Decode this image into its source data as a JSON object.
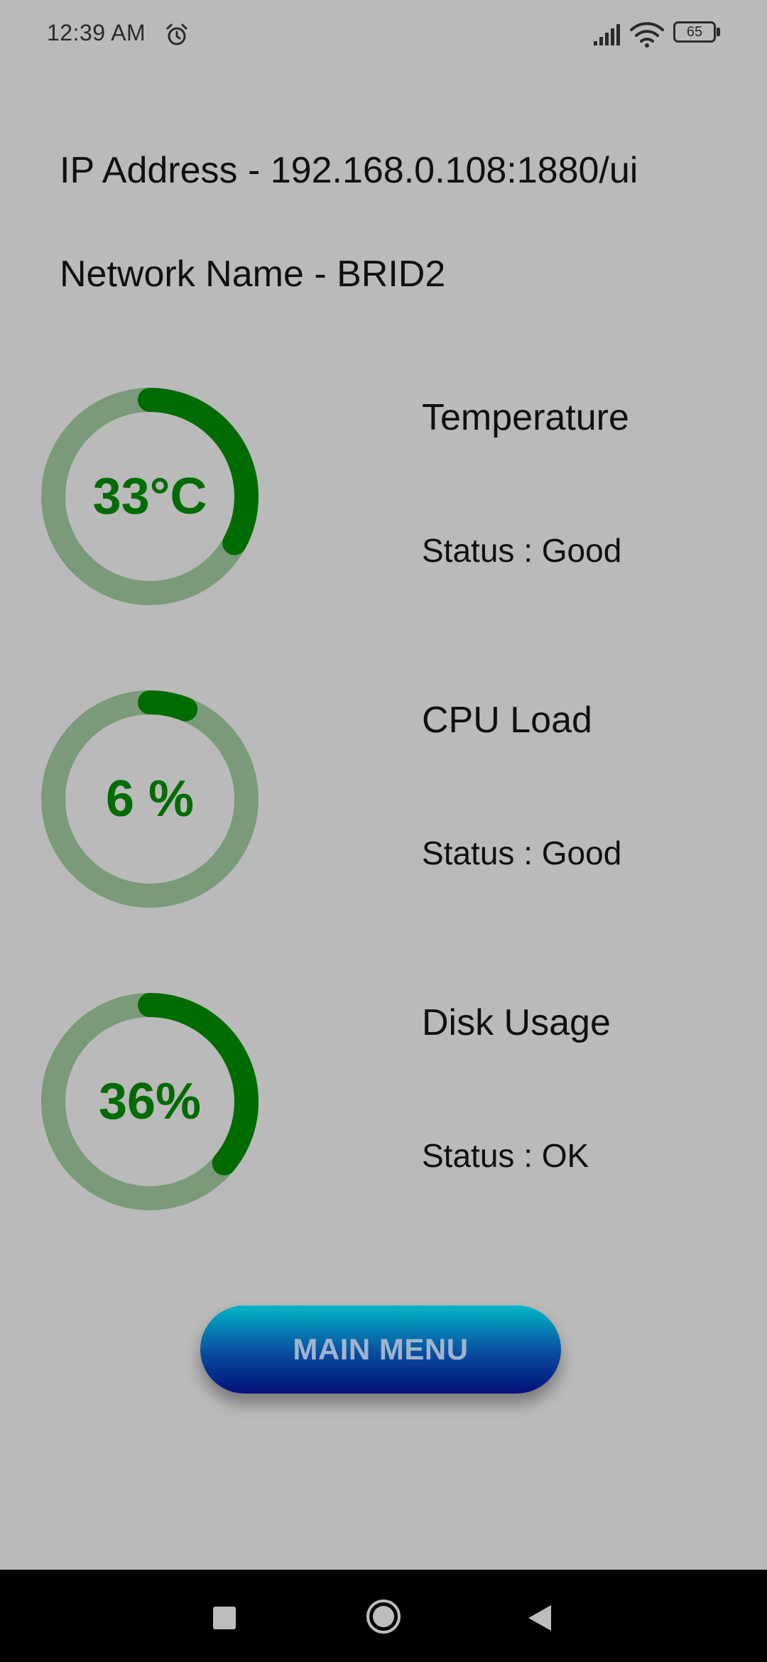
{
  "status_bar": {
    "time": "12:39 AM",
    "battery_level": "65",
    "icons": [
      "alarm-icon",
      "signal-icon",
      "wifi-icon",
      "battery-icon"
    ]
  },
  "network": {
    "ip_line": "IP Address - 192.168.0.108:1880/ui",
    "name_line": "Network Name - BRID2"
  },
  "metrics": [
    {
      "title": "Temperature",
      "value_text": "33°C",
      "status": "Status : Good",
      "fill_fraction": 0.33
    },
    {
      "title": "CPU Load",
      "value_text": "6 %",
      "status": "Status : Good",
      "fill_fraction": 0.06
    },
    {
      "title": "Disk Usage",
      "value_text": "36%",
      "status": "Status : OK",
      "fill_fraction": 0.36
    }
  ],
  "main_menu": {
    "label": "MAIN MENU"
  },
  "colors": {
    "background": "#bababa",
    "gauge_track": "#7a9a7a",
    "gauge_fill": "#006b00",
    "gauge_text": "#006b00",
    "button_top": "#00b6c6",
    "button_bottom": "#02107a",
    "button_text": "#9fb4cf"
  },
  "nav_bar": {
    "icons": [
      "recent-apps-icon",
      "home-icon",
      "back-icon"
    ]
  }
}
